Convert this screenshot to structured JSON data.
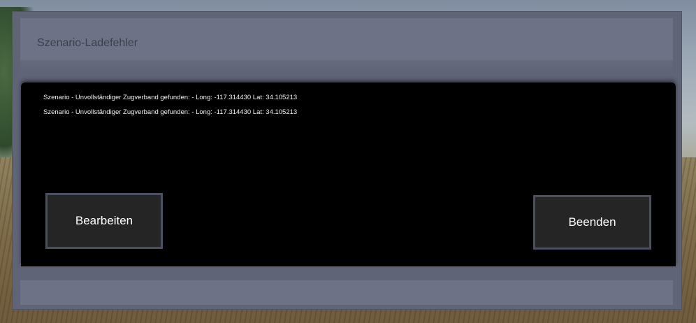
{
  "dialog": {
    "title": "Szenario-Ladefehler",
    "log": [
      "Szenario - Unvollständiger Zugverband gefunden: - Long: -117.314430 Lat: 34.105213",
      "Szenario - Unvollständiger Zugverband gefunden: - Long: -117.314430 Lat: 34.105213"
    ],
    "buttons": {
      "edit": "Bearbeiten",
      "quit": "Beenden"
    }
  },
  "colors": {
    "frame": "#5f6476",
    "titlebar": "#6e7286",
    "panel": "#000000",
    "button": "#252525",
    "button_border": "#4a4f62"
  }
}
